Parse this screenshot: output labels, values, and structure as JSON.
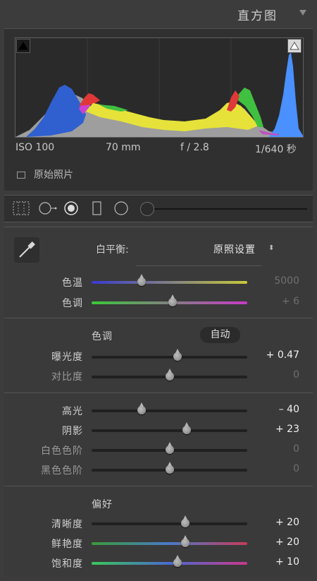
{
  "header": {
    "title": "直方图"
  },
  "histogram": {
    "exif": {
      "iso": "ISO 100",
      "focal": "70 mm",
      "aperture": "f / 2.8",
      "shutter": "1/640 秒"
    },
    "original_label": "原始照片"
  },
  "basic": {
    "white_balance": {
      "label": "白平衡:",
      "value": "原照设置"
    },
    "temp": {
      "label": "色温",
      "value": "5000",
      "position": 0.32
    },
    "tint": {
      "label": "色调",
      "value": "+ 6",
      "position": 0.52
    },
    "tone": {
      "title": "色调",
      "auto_label": "自动"
    },
    "exposure": {
      "label": "曝光度",
      "value": "+ 0.47",
      "position": 0.55
    },
    "contrast": {
      "label": "对比度",
      "value": "0",
      "position": 0.5
    },
    "highlights": {
      "label": "高光",
      "value": "– 40",
      "position": 0.32
    },
    "shadows": {
      "label": "阴影",
      "value": "+ 23",
      "position": 0.61
    },
    "whites": {
      "label": "白色色阶",
      "value": "0",
      "position": 0.5
    },
    "blacks": {
      "label": "黑色色阶",
      "value": "0",
      "position": 0.5
    },
    "presence": {
      "title": "偏好"
    },
    "clarity": {
      "label": "清晰度",
      "value": "+ 20",
      "position": 0.6
    },
    "vibrance": {
      "label": "鲜艳度",
      "value": "+ 20",
      "position": 0.6
    },
    "saturation": {
      "label": "饱和度",
      "value": "+ 10",
      "position": 0.55
    }
  },
  "colors": {
    "temp_track": [
      "#3a3ad0",
      "#c8c83a"
    ],
    "tint_track": [
      "#3ac83a",
      "#c83ac8"
    ],
    "vibrance_track": [
      "#3a9a3a",
      "#4a7ac8",
      "#c83a5a"
    ],
    "saturation_track": [
      "#3ac85a",
      "#4a6ad0",
      "#c83a8a"
    ]
  },
  "icons": [
    "shadow-clip-icon",
    "highlight-clip-icon",
    "crop-overlay-icon",
    "spot-removal-icon",
    "red-eye-icon",
    "graduated-filter-icon",
    "radial-filter-icon",
    "adjustment-brush-icon",
    "eyedropper-icon"
  ]
}
